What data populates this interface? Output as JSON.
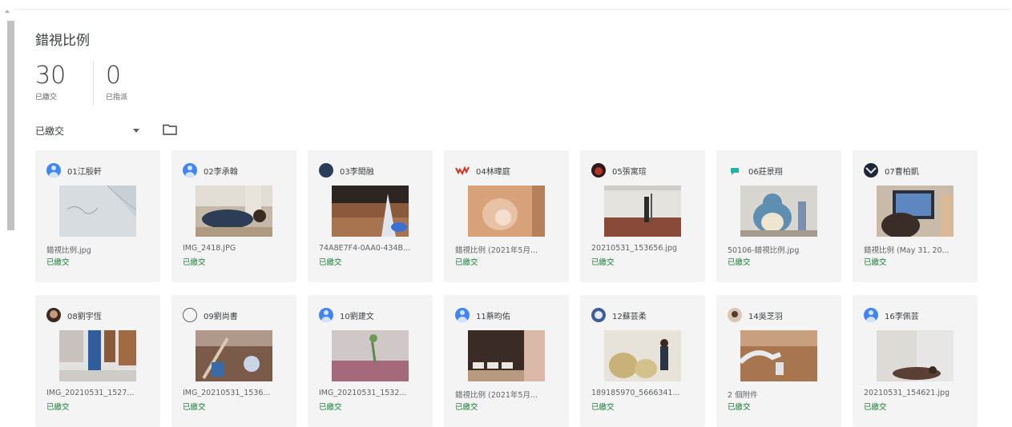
{
  "page": {
    "title": "錯視比例",
    "stats": [
      {
        "value": "30",
        "label": "已繳交"
      },
      {
        "value": "0",
        "label": "已指派"
      }
    ],
    "filter": {
      "selected": "已繳交"
    }
  },
  "submissions": [
    {
      "student": "01江殷軒",
      "file": "錯視比例.jpg",
      "status": "已繳交"
    },
    {
      "student": "02李承翰",
      "file": "IMG_2418.JPG",
      "status": "已繳交"
    },
    {
      "student": "03李閎融",
      "file": "74A8E7F4-0AA0-434B...",
      "status": "已繳交"
    },
    {
      "student": "04林暐庭",
      "file": "錯視比例 (2021年5月...",
      "status": "已繳交"
    },
    {
      "student": "05張寓瑄",
      "file": "20210531_153656.jpg",
      "status": "已繳交"
    },
    {
      "student": "06莊景翔",
      "file": "50106-錯視比例.jpg",
      "status": "已繳交"
    },
    {
      "student": "07曹柏凱",
      "file": "錯視比例 (May 31, 20...",
      "status": "已繳交"
    },
    {
      "student": "08劉宇恆",
      "file": "IMG_20210531_1527...",
      "status": "已繳交"
    },
    {
      "student": "09劉尚書",
      "file": "IMG_20210531_1536...",
      "status": "已繳交"
    },
    {
      "student": "10劉建文",
      "file": "IMG_20210531_1532...",
      "status": "已繳交"
    },
    {
      "student": "11蔡昀佑",
      "file": "錯視比例 (2021年5月...",
      "status": "已繳交"
    },
    {
      "student": "12蘇芸柔",
      "file": "189185970_5666341...",
      "status": "已繳交"
    },
    {
      "student": "14吳芝羽",
      "file": "2 個附件",
      "status": "已繳交"
    },
    {
      "student": "16李佩芸",
      "file": "20210531_154621.jpg",
      "status": "已繳交"
    }
  ]
}
